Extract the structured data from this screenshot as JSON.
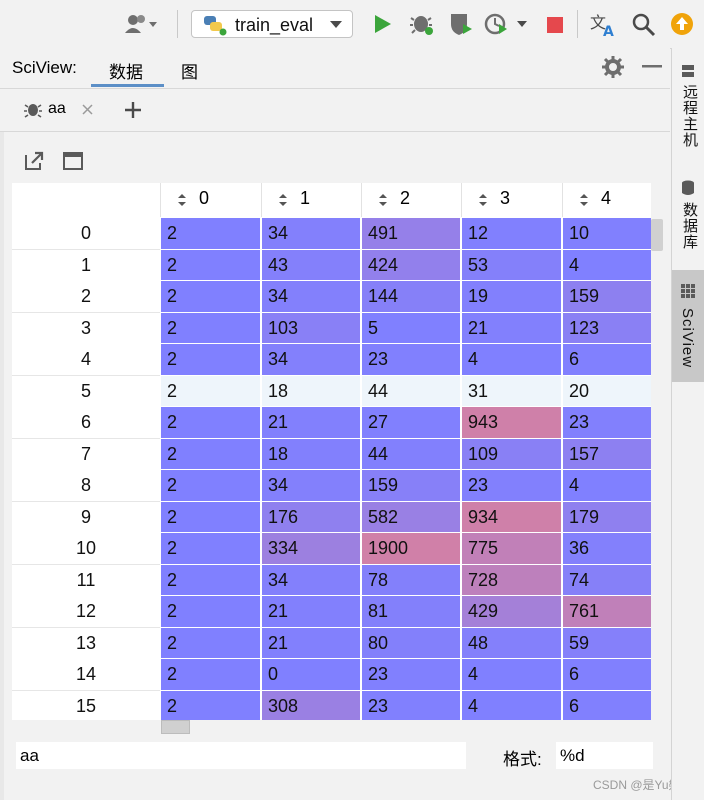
{
  "toolbar": {
    "run_config": "train_eval",
    "colors": {
      "run_green": "#3ba53b",
      "stop_red": "#e5484d",
      "update_orange": "#f0a30a"
    }
  },
  "panel": {
    "title": "SciView:",
    "tabs": [
      {
        "label": "数据",
        "active": true
      },
      {
        "label": "图",
        "active": false
      }
    ]
  },
  "file_tab": {
    "label": "aa"
  },
  "right_strip": {
    "tabs": [
      {
        "label": "远程主机",
        "icon": "server-icon",
        "active": false
      },
      {
        "label": "数据库",
        "icon": "database-icon",
        "active": false
      },
      {
        "label": "SciView",
        "icon": "sciview-icon",
        "active": true
      }
    ]
  },
  "table": {
    "columns": [
      "0",
      "1",
      "2",
      "3",
      "4"
    ],
    "rows": [
      {
        "index": "0",
        "cells": [
          "2",
          "34",
          "491",
          "12",
          "10"
        ]
      },
      {
        "index": "1",
        "cells": [
          "2",
          "43",
          "424",
          "53",
          "4"
        ]
      },
      {
        "index": "2",
        "cells": [
          "2",
          "34",
          "144",
          "19",
          "159"
        ]
      },
      {
        "index": "3",
        "cells": [
          "2",
          "103",
          "5",
          "21",
          "123"
        ]
      },
      {
        "index": "4",
        "cells": [
          "2",
          "34",
          "23",
          "4",
          "6"
        ]
      },
      {
        "index": "5",
        "cells": [
          "2",
          "18",
          "44",
          "31",
          "20"
        ],
        "selected": true
      },
      {
        "index": "6",
        "cells": [
          "2",
          "21",
          "27",
          "943",
          "23"
        ]
      },
      {
        "index": "7",
        "cells": [
          "2",
          "18",
          "44",
          "109",
          "157"
        ]
      },
      {
        "index": "8",
        "cells": [
          "2",
          "34",
          "159",
          "23",
          "4"
        ]
      },
      {
        "index": "9",
        "cells": [
          "2",
          "176",
          "582",
          "934",
          "179"
        ]
      },
      {
        "index": "10",
        "cells": [
          "2",
          "334",
          "1900",
          "775",
          "36"
        ]
      },
      {
        "index": "11",
        "cells": [
          "2",
          "34",
          "78",
          "728",
          "74"
        ]
      },
      {
        "index": "12",
        "cells": [
          "2",
          "21",
          "81",
          "429",
          "761"
        ]
      },
      {
        "index": "13",
        "cells": [
          "2",
          "21",
          "80",
          "48",
          "59"
        ]
      },
      {
        "index": "14",
        "cells": [
          "2",
          "0",
          "23",
          "4",
          "6"
        ]
      },
      {
        "index": "15",
        "cells": [
          "2",
          "308",
          "23",
          "4",
          "6"
        ]
      }
    ],
    "colors": {
      "low": "#8080ff",
      "high": "#d080a8",
      "selected_row": "#eef5fb"
    }
  },
  "bottom": {
    "variable_name": "aa",
    "format_label": "格式:",
    "format_value": "%d"
  },
  "watermark": "CSDN @是Yu欸"
}
